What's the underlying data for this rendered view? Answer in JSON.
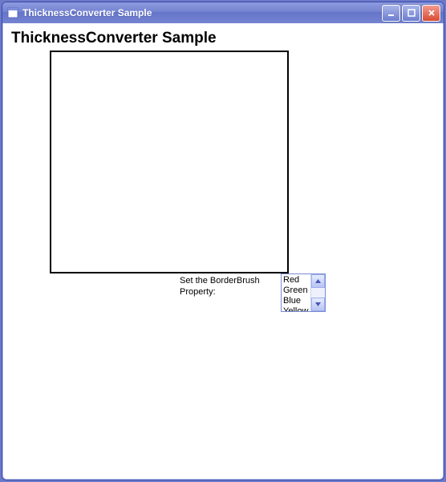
{
  "window": {
    "title": "ThicknessConverter Sample"
  },
  "content": {
    "heading": "ThicknessConverter Sample",
    "borderbrush_label": "Set the BorderBrush Property:"
  },
  "listbox": {
    "items": [
      "Red",
      "Green",
      "Blue",
      "Yellow"
    ]
  }
}
